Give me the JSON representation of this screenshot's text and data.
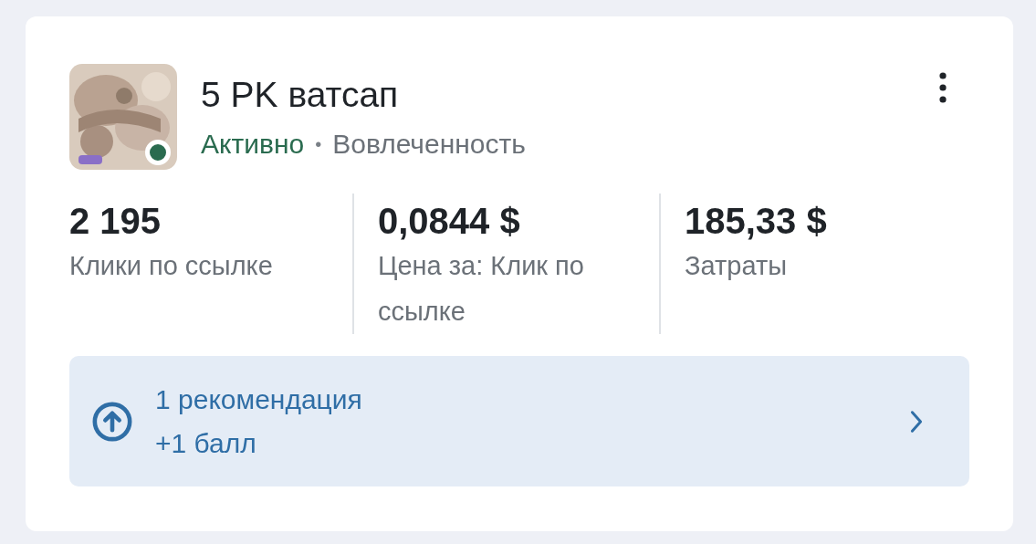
{
  "ad": {
    "title": "5 PK ватсап",
    "active": true,
    "status": "Активно",
    "separator": "•",
    "goal": "Вовлеченность"
  },
  "metrics": [
    {
      "value": "2 195",
      "label": "Клики по ссылке"
    },
    {
      "value": "0,0844 $",
      "label": "Цена за: Клик по ссылке"
    },
    {
      "value": "185,33 $",
      "label": "Затраты"
    }
  ],
  "recommendation": {
    "title": "1 рекомендация",
    "subtitle": "+1 балл"
  }
}
